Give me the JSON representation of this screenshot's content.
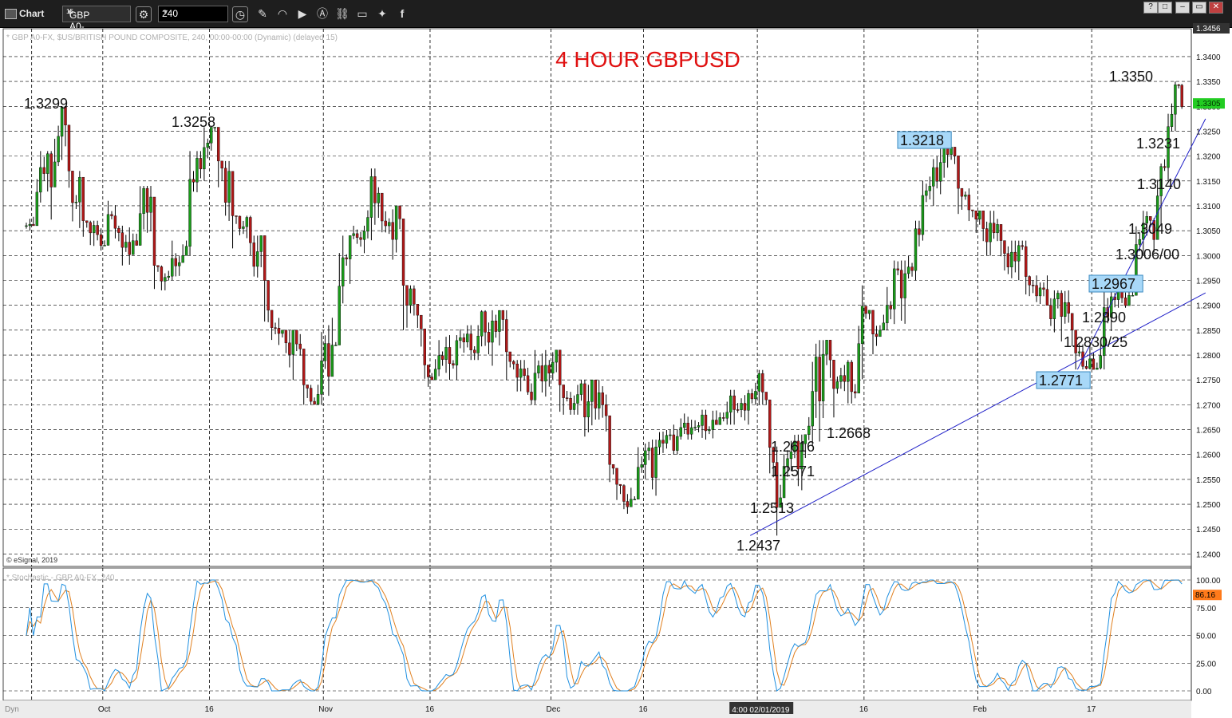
{
  "window": {
    "label": "Chart",
    "symbol": "GBP A0-FX",
    "symbol_superscript": "15",
    "interval": "240",
    "buttons": [
      "?",
      "□",
      "–",
      "▭",
      "✕"
    ]
  },
  "price_pane": {
    "info": "* GBP A0-FX, $US/BRITISH POUND COMPOSITE, 240, 00:00-00:00 (Dynamic) (delayed 15)",
    "copyright": "© eSignal, 2019",
    "current_price_label": "1.3305",
    "top_label": "1.3456"
  },
  "stoch_pane": {
    "info": "* Stochastic - GBP A0-FX, 240",
    "current_label": "86.16",
    "yticks": [
      "100.00",
      "75.00",
      "50.00",
      "25.00",
      "0.00"
    ]
  },
  "bottom_bar": {
    "mode": "Dyn",
    "cursor_date": "4:00 02/01/2019"
  },
  "colors": {
    "up": "#1a9a1a",
    "down": "#b01818",
    "trendline": "#2020c8",
    "stoch_k": "#2090e0",
    "stoch_d": "#e08020",
    "title": "#e01010",
    "badge": "#a8d8f8",
    "current": "#22cc22",
    "stoch_current": "#ff7a1a"
  },
  "chart_data": {
    "type": "candlestick",
    "title": "4 HOUR GBPUSD",
    "ylim": [
      1.2375,
      1.3456
    ],
    "yticks": [
      1.24,
      1.245,
      1.25,
      1.255,
      1.26,
      1.265,
      1.27,
      1.275,
      1.28,
      1.285,
      1.29,
      1.295,
      1.3,
      1.305,
      1.31,
      1.315,
      1.32,
      1.325,
      1.33,
      1.335,
      1.34
    ],
    "xticks": [
      "Oct",
      "16",
      "Nov",
      "16",
      "Dec",
      "16",
      "16",
      "Feb",
      "17"
    ],
    "series": [
      {
        "name": "GBP A0-FX",
        "x": [
          "2018-09-20",
          "2018-09-21",
          "2018-09-24",
          "2018-09-26",
          "2018-09-28",
          "2018-10-01",
          "2018-10-03",
          "2018-10-05",
          "2018-10-08",
          "2018-10-10",
          "2018-10-12",
          "2018-10-15",
          "2018-10-17",
          "2018-10-19",
          "2018-10-22",
          "2018-10-24",
          "2018-10-26",
          "2018-10-29",
          "2018-10-31",
          "2018-11-02",
          "2018-11-05",
          "2018-11-07",
          "2018-11-09",
          "2018-11-12",
          "2018-11-14",
          "2018-11-15",
          "2018-11-16",
          "2018-11-20",
          "2018-11-23",
          "2018-11-27",
          "2018-11-30",
          "2018-12-04",
          "2018-12-07",
          "2018-12-11",
          "2018-12-12",
          "2018-12-14",
          "2018-12-18",
          "2018-12-21",
          "2018-12-26",
          "2018-12-31",
          "2019-01-02",
          "2019-01-03",
          "2019-01-04",
          "2019-01-08",
          "2019-01-11",
          "2019-01-15",
          "2019-01-16",
          "2019-01-18",
          "2019-01-22",
          "2019-01-24",
          "2019-01-25",
          "2019-01-29",
          "2019-01-31",
          "2019-02-04",
          "2019-02-08",
          "2019-02-11",
          "2019-02-14",
          "2019-02-15",
          "2019-02-18",
          "2019-02-20",
          "2019-02-22",
          "2019-02-25",
          "2019-02-26",
          "2019-02-27",
          "2019-02-28",
          "2019-03-01"
        ],
        "close": [
          1.306,
          1.318,
          1.3299,
          1.313,
          1.304,
          1.308,
          1.302,
          1.311,
          1.295,
          1.3,
          1.317,
          1.3258,
          1.315,
          1.305,
          1.3,
          1.285,
          1.282,
          1.27,
          1.282,
          1.3,
          1.303,
          1.314,
          1.307,
          1.29,
          1.285,
          1.275,
          1.28,
          1.282,
          1.286,
          1.275,
          1.278,
          1.27,
          1.272,
          1.255,
          1.251,
          1.26,
          1.263,
          1.266,
          1.27,
          1.274,
          1.266,
          1.2513,
          1.2616,
          1.28,
          1.275,
          1.29,
          1.285,
          1.295,
          1.303,
          1.312,
          1.3218,
          1.31,
          1.305,
          1.3,
          1.292,
          1.29,
          1.282,
          1.2771,
          1.2895,
          1.292,
          1.305,
          1.304,
          1.315,
          1.325,
          1.335,
          1.3305
        ],
        "high": [
          1.309,
          1.321,
          1.3299,
          1.317,
          1.307,
          1.311,
          1.306,
          1.314,
          1.298,
          1.303,
          1.321,
          1.3258,
          1.319,
          1.308,
          1.304,
          1.289,
          1.285,
          1.274,
          1.286,
          1.304,
          1.306,
          1.3175,
          1.31,
          1.294,
          1.288,
          1.278,
          1.284,
          1.286,
          1.289,
          1.279,
          1.281,
          1.274,
          1.275,
          1.258,
          1.254,
          1.263,
          1.266,
          1.269,
          1.273,
          1.277,
          1.271,
          1.2616,
          1.264,
          1.283,
          1.279,
          1.294,
          1.289,
          1.299,
          1.307,
          1.316,
          1.3218,
          1.3135,
          1.309,
          1.303,
          1.296,
          1.293,
          1.285,
          1.283,
          1.2935,
          1.296,
          1.309,
          1.3075,
          1.3185,
          1.3285,
          1.335,
          1.3345
        ],
        "low": [
          1.303,
          1.306,
          1.318,
          1.303,
          1.301,
          1.302,
          1.298,
          1.302,
          1.293,
          1.295,
          1.3,
          1.315,
          1.305,
          1.3,
          1.285,
          1.282,
          1.275,
          1.27,
          1.27,
          1.282,
          1.3,
          1.303,
          1.29,
          1.285,
          1.275,
          1.272,
          1.275,
          1.279,
          1.275,
          1.272,
          1.27,
          1.268,
          1.255,
          1.25,
          1.248,
          1.251,
          1.26,
          1.263,
          1.266,
          1.27,
          1.2437,
          1.2437,
          1.2513,
          1.26,
          1.2668,
          1.275,
          1.28,
          1.285,
          1.295,
          1.303,
          1.31,
          1.305,
          1.3,
          1.292,
          1.29,
          1.282,
          1.2771,
          1.2771,
          1.2771,
          1.2895,
          1.292,
          1.3006,
          1.3049,
          1.315,
          1.325,
          1.3295
        ]
      }
    ],
    "trendlines": [
      {
        "from": [
          "2018-12-31",
          1.2437
        ],
        "to": [
          "2019-03-05",
          1.2925
        ]
      },
      {
        "from": [
          "2019-02-15",
          1.2771
        ],
        "to": [
          "2019-03-05",
          1.3275
        ]
      }
    ],
    "annotations": [
      {
        "text": "1.3299",
        "boxed": false
      },
      {
        "text": "1.3258",
        "boxed": false
      },
      {
        "text": "1.3218",
        "boxed": true
      },
      {
        "text": "1.3350",
        "boxed": false
      },
      {
        "text": "1.3231",
        "boxed": false
      },
      {
        "text": "1.3140",
        "boxed": false
      },
      {
        "text": "1.3049",
        "boxed": false
      },
      {
        "text": "1.3006/00",
        "boxed": false
      },
      {
        "text": "1.2967",
        "boxed": true
      },
      {
        "text": "1.2890",
        "boxed": false
      },
      {
        "text": "1.2830/25",
        "boxed": false
      },
      {
        "text": "1.2771",
        "boxed": true
      },
      {
        "text": "1.2668",
        "boxed": false
      },
      {
        "text": "1.2616",
        "boxed": false
      },
      {
        "text": "1.2571",
        "boxed": false
      },
      {
        "text": "1.2513",
        "boxed": false
      },
      {
        "text": "1.2437",
        "boxed": false
      }
    ]
  }
}
